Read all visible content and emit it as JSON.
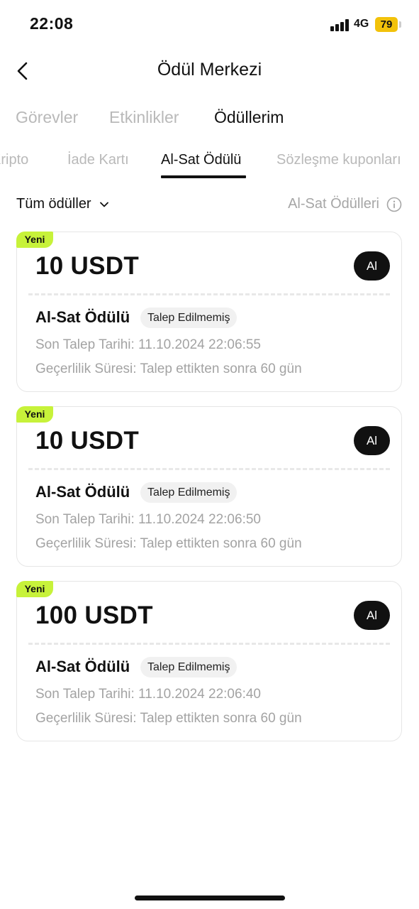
{
  "status_bar": {
    "time": "22:08",
    "network": "4G",
    "battery": "79"
  },
  "header": {
    "title": "Ödül Merkezi",
    "back_icon": "chevron-left-icon"
  },
  "main_tabs": [
    {
      "label": "Görevler",
      "active": false
    },
    {
      "label": "Etkinlikler",
      "active": false
    },
    {
      "label": "Ödüllerim",
      "active": true
    }
  ],
  "sub_tabs": [
    {
      "label": "Kripto",
      "active": false
    },
    {
      "label": "İade Kartı",
      "active": false
    },
    {
      "label": "Al-Sat Ödülü",
      "active": true
    },
    {
      "label": "Sözleşme kuponları",
      "active": false
    }
  ],
  "filter": {
    "dropdown_label": "Tüm ödüller",
    "info_label": "Al-Sat Ödülleri"
  },
  "rewards": [
    {
      "badge": "Yeni",
      "amount": "10 USDT",
      "button_label": "Al",
      "name": "Al-Sat Ödülü",
      "status": "Talep Edilmemiş",
      "deadline": "Son Talep Tarihi: 11.10.2024 22:06:55",
      "validity": "Geçerlilik Süresi: Talep ettikten sonra 60 gün"
    },
    {
      "badge": "Yeni",
      "amount": "10 USDT",
      "button_label": "Al",
      "name": "Al-Sat Ödülü",
      "status": "Talep Edilmemiş",
      "deadline": "Son Talep Tarihi: 11.10.2024 22:06:50",
      "validity": "Geçerlilik Süresi: Talep ettikten sonra 60 gün"
    },
    {
      "badge": "Yeni",
      "amount": "100 USDT",
      "button_label": "Al",
      "name": "Al-Sat Ödülü",
      "status": "Talep Edilmemiş",
      "deadline": "Son Talep Tarihi: 11.10.2024 22:06:40",
      "validity": "Geçerlilik Süresi: Talep ettikten sonra 60 gün"
    }
  ],
  "colors": {
    "accent_badge": "#c7f23a",
    "battery": "#f2c20a",
    "muted_text": "#a3a3a3"
  }
}
